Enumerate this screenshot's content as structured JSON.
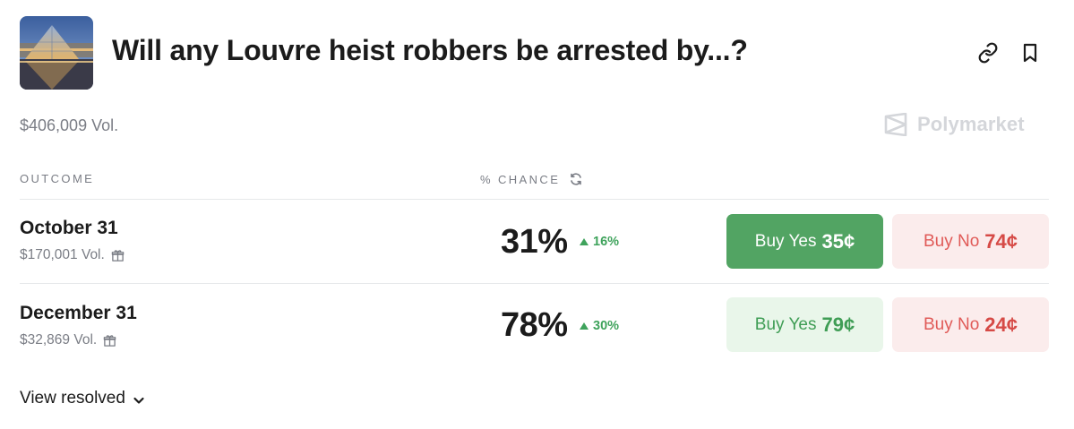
{
  "market": {
    "title": "Will any Louvre heist robbers be arrested by...?",
    "volume": "$406,009 Vol.",
    "brand": "Polymarket",
    "thumbnail_icon": "louvre-pyramid-image"
  },
  "table": {
    "col_outcome": "OUTCOME",
    "col_chance": "% CHANCE"
  },
  "outcomes": [
    {
      "name": "October 31",
      "volume": "$170,001 Vol.",
      "chance": "31%",
      "change": "16%",
      "yes_label": "Buy Yes",
      "yes_price": "35¢",
      "no_label": "Buy No",
      "no_price": "74¢"
    },
    {
      "name": "December 31",
      "volume": "$32,869 Vol.",
      "chance": "78%",
      "change": "30%",
      "yes_label": "Buy Yes",
      "yes_price": "79¢",
      "no_label": "Buy No",
      "no_price": "24¢"
    }
  ],
  "footer": {
    "view_resolved": "View resolved"
  },
  "colors": {
    "yes_solid": "#52a463",
    "yes_soft": "#e9f6ea",
    "no_soft": "#fbecec",
    "no_text": "#e05a57",
    "up": "#3fa35c"
  }
}
